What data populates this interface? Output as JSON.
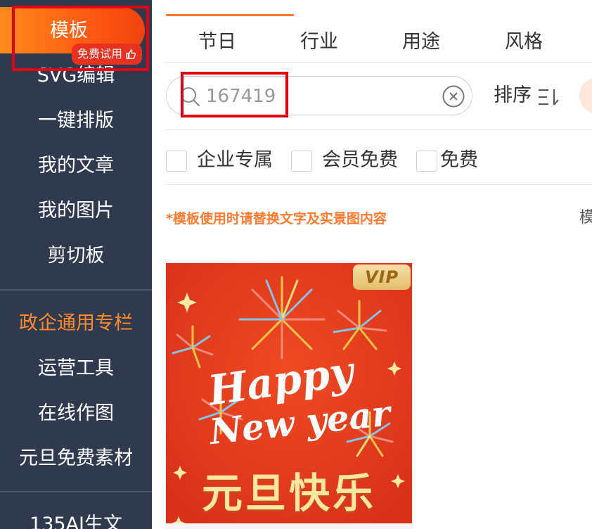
{
  "sidebar": {
    "active_item": "模板",
    "trial_badge": "免费试用",
    "items": [
      "SVG编辑",
      "一键排版",
      "我的文章",
      "我的图片",
      "剪切板"
    ],
    "section_title": "政企通用专栏",
    "section_items": [
      "运营工具",
      "在线作图",
      "元旦免费素材"
    ],
    "bottom_item": "135AI生文"
  },
  "main": {
    "tabs": [
      "节日",
      "行业",
      "用途",
      "风格"
    ],
    "active_tab_index": 0,
    "search": {
      "value": "167419",
      "placeholder": ""
    },
    "sort_label": "排序",
    "filters": [
      "企业专属",
      "会员免费",
      "免费"
    ],
    "notice": "*模板使用时请替换文字及实景图内容",
    "right_peek_text": "模"
  },
  "card": {
    "vip_label": "VIP",
    "headline_line1": "Happy",
    "headline_line2": "New year",
    "title": "元旦快乐"
  },
  "colors": {
    "sidebar_bg": "#2f3a4e",
    "accent": "#ff7a2e",
    "highlight": "#e60012",
    "card_bg": "#e83a1e"
  }
}
